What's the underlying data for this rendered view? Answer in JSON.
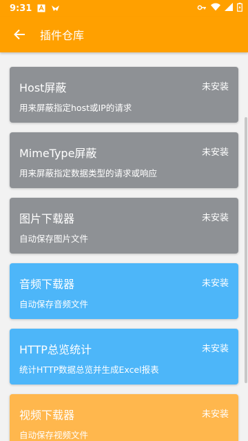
{
  "status_bar": {
    "time": "9:31",
    "left_icons": [
      "a-box-icon",
      "bird-icon"
    ],
    "right_icons": [
      "vpn-key-icon",
      "wifi-icon",
      "signal-icon",
      "battery-icon"
    ]
  },
  "app_bar": {
    "title": "插件仓库",
    "back_icon": "arrow-back-icon"
  },
  "colors": {
    "primary": "#ffa000",
    "gray_card": "#8e9195",
    "blue_card": "#4db6f9",
    "orange_card": "#ffb74d"
  },
  "plugins": [
    {
      "name": "Host屏蔽",
      "status": "未安装",
      "desc": "用来屏蔽指定host或IP的请求",
      "color": "#8e9195"
    },
    {
      "name": "MimeType屏蔽",
      "status": "未安装",
      "desc": "用来屏蔽指定数据类型的请求或响应",
      "color": "#8e9195"
    },
    {
      "name": "图片下载器",
      "status": "未安装",
      "desc": "自动保存图片文件",
      "color": "#8e9195"
    },
    {
      "name": "音频下载器",
      "status": "未安装",
      "desc": "自动保存音频文件",
      "color": "#4db6f9"
    },
    {
      "name": "HTTP总览统计",
      "status": "未安装",
      "desc": "统计HTTP数据总览并生成Excel报表",
      "color": "#4db6f9"
    },
    {
      "name": "视频下载器",
      "status": "未安装",
      "desc": "自动保存视频文件",
      "color": "#ffb74d"
    }
  ]
}
